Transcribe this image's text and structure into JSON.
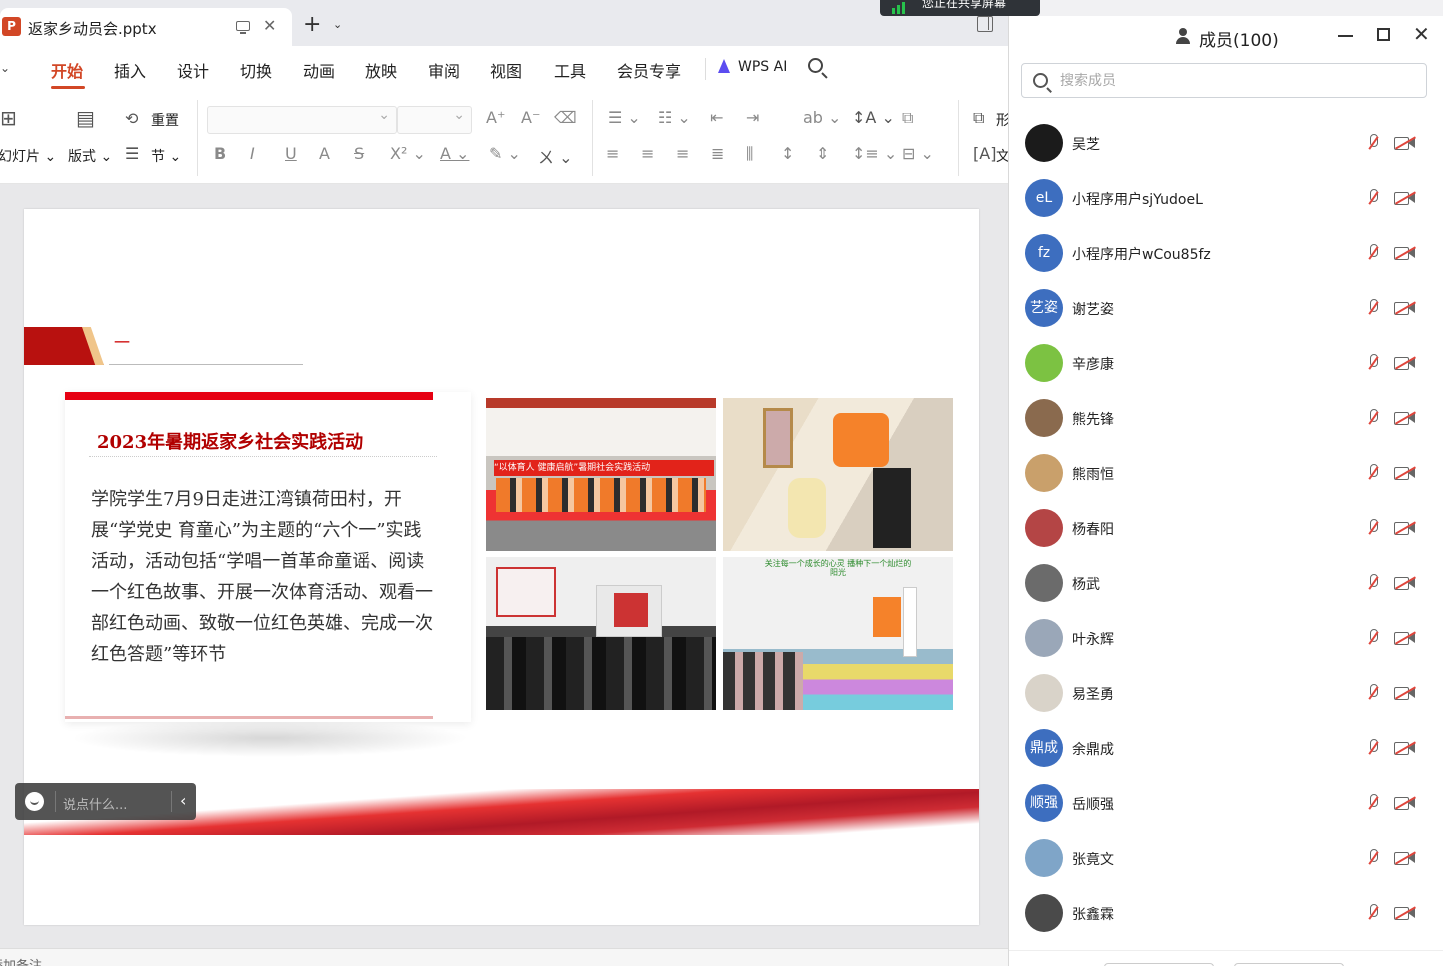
{
  "window": {
    "doc_tab_title": "返家乡动员会.pptx",
    "share_banner": "您正在共享屏幕"
  },
  "menu": {
    "items": [
      "开始",
      "插入",
      "设计",
      "切换",
      "动画",
      "放映",
      "审阅",
      "视图",
      "工具",
      "会员专享"
    ],
    "active": "开始",
    "ai_label": "WPS AI",
    "accent_color": "#d24726"
  },
  "ribbon": {
    "slide_label": "幻灯片",
    "layout_label": "版式",
    "reset_label": "重置",
    "section_label": "节",
    "shape_label_partial": "形",
    "text_label_partial": "文"
  },
  "slide": {
    "dash": "一",
    "card_title": "2023年暑期返家乡社会实践活动",
    "card_body": "学院学生7月9日走进江湾镇荷田村，开展“学党史 育童心”为主题的“六个一”实践活动，活动包括“学唱一首革命童谣、阅读一个红色故事、开展一次体育活动、观看一部红色动画、致敬一位红色英雄、完成一次红色答题”等环节",
    "photo1_banner": "“以体育人  健康启航”暑期社会实践活动",
    "photo4_banner": "关注每一个成长的心灵 播种下一个灿烂的阳光"
  },
  "chat": {
    "placeholder": "说点什么..."
  },
  "notes": {
    "placeholder": "添加备注"
  },
  "panel": {
    "title": "成员(100)",
    "search_placeholder": "搜索成员",
    "members": [
      {
        "name": "吴芝",
        "avatar_text": "",
        "avatar_color": "#1b1b1b"
      },
      {
        "name": "小程序用户sjYudoeL",
        "avatar_text": "eL",
        "avatar_color": "#3d6ebf"
      },
      {
        "name": "小程序用户wCou85fz",
        "avatar_text": "fz",
        "avatar_color": "#3d6ebf"
      },
      {
        "name": "谢艺姿",
        "avatar_text": "艺姿",
        "avatar_color": "#3d6ebf"
      },
      {
        "name": "辛彦康",
        "avatar_text": "",
        "avatar_color": "#7cc242"
      },
      {
        "name": "熊先锋",
        "avatar_text": "",
        "avatar_color": "#8a6a4e"
      },
      {
        "name": "熊雨恒",
        "avatar_text": "",
        "avatar_color": "#c9a06b"
      },
      {
        "name": "杨春阳",
        "avatar_text": "",
        "avatar_color": "#b44545"
      },
      {
        "name": "杨武",
        "avatar_text": "",
        "avatar_color": "#6b6b6b"
      },
      {
        "name": "叶永辉",
        "avatar_text": "",
        "avatar_color": "#9aa7b8"
      },
      {
        "name": "易圣勇",
        "avatar_text": "",
        "avatar_color": "#d9d3c9"
      },
      {
        "name": "余鼎成",
        "avatar_text": "鼎成",
        "avatar_color": "#3d6ebf"
      },
      {
        "name": "岳顺强",
        "avatar_text": "顺强",
        "avatar_color": "#3d6ebf"
      },
      {
        "name": "张竟文",
        "avatar_text": "",
        "avatar_color": "#7fa5c8"
      },
      {
        "name": "张鑫霖",
        "avatar_text": "",
        "avatar_color": "#4a4a4a"
      }
    ]
  }
}
